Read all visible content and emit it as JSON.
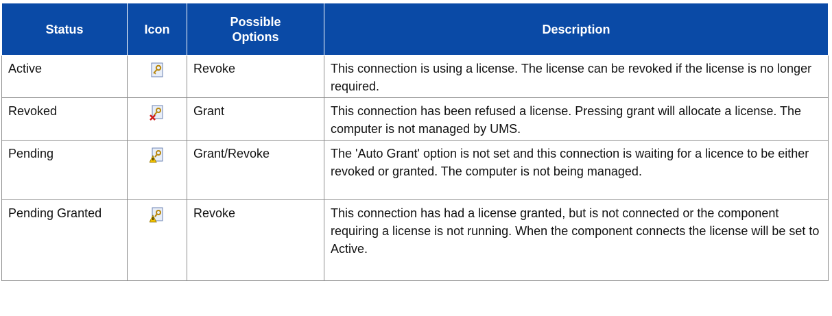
{
  "table": {
    "headers": {
      "status": "Status",
      "icon": "Icon",
      "options": "Possible Options",
      "description": "Description"
    },
    "rows": [
      {
        "status": "Active",
        "icon": "key-document-icon",
        "options": "Revoke",
        "description": "This connection is using a license.  The license can be revoked if the license is no longer required."
      },
      {
        "status": "Revoked",
        "icon": "key-document-red-x-icon",
        "options": "Grant",
        "description": "This connection has been refused a license.  Pressing grant will allocate a license. The computer is not managed by UMS."
      },
      {
        "status": "Pending",
        "icon": "key-document-warning-icon",
        "options": "Grant/Revoke",
        "description": "The 'Auto Grant' option is not set and this connection is waiting for a licence to be either revoked or granted. The computer is not being managed."
      },
      {
        "status": "Pending Granted",
        "icon": "key-document-warning-icon",
        "options": "Revoke",
        "description": "This connection has had a license granted, but is not connected or the component requiring a license is not running.  When the component connects the license will be set to Active."
      }
    ]
  }
}
